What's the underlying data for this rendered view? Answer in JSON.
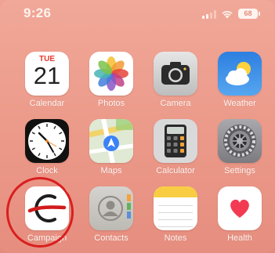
{
  "status_bar": {
    "time": "9:26",
    "battery": "68"
  },
  "calendar": {
    "weekday": "TUE",
    "date": "21"
  },
  "apps": [
    {
      "label": "Calendar"
    },
    {
      "label": "Photos"
    },
    {
      "label": "Camera"
    },
    {
      "label": "Weather"
    },
    {
      "label": "Clock"
    },
    {
      "label": "Maps"
    },
    {
      "label": "Calculator"
    },
    {
      "label": "Settings"
    },
    {
      "label": "Campaign"
    },
    {
      "label": "Contacts"
    },
    {
      "label": "Notes"
    },
    {
      "label": "Health"
    }
  ],
  "colors": {
    "wallpaper": "#ec9a8a",
    "highlight": "#d91f1f",
    "campaign_stroke": "#d21a1a"
  }
}
